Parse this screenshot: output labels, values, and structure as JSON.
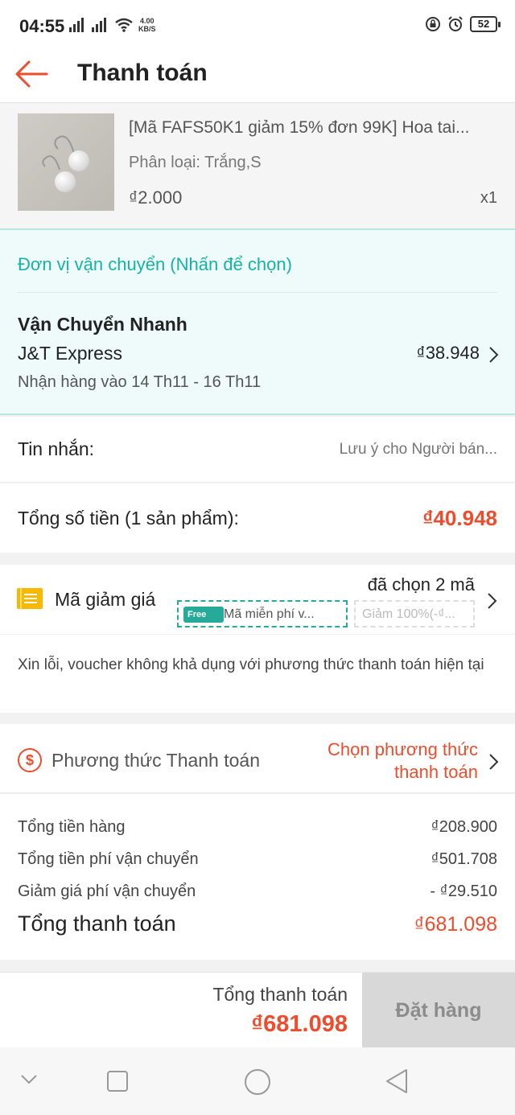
{
  "status": {
    "time": "04:55",
    "net_speed": "4.00",
    "net_unit": "KB/S",
    "battery": "52"
  },
  "header": {
    "title": "Thanh toán"
  },
  "product": {
    "name": "[Mã FAFS50K1 giảm 15% đơn 99K] Hoa tai...",
    "variant": "Phân loại: Trắng,S",
    "price": "₫2.000",
    "qty": "x1"
  },
  "shipping": {
    "header": "Đơn vị vận chuyển (Nhấn để chọn)",
    "type": "Vận Chuyển Nhanh",
    "carrier": "J&T Express",
    "fee": "₫38.948",
    "eta": "Nhận hàng vào 14 Th11 - 16 Th11"
  },
  "message": {
    "label": "Tin nhắn:",
    "placeholder": "Lưu ý cho Người bán..."
  },
  "subtotal": {
    "label": "Tổng số tiền (1 sản phẩm):",
    "value": "₫40.948"
  },
  "voucher": {
    "label": "Mã giảm giá",
    "selected": "đã chọn 2 mã",
    "free_tag": "Free",
    "chip1": "Mã miễn phí v...",
    "chip2": "Giảm 100%(-₫...",
    "warning": "Xin lỗi, voucher không khả dụng với phương thức thanh toán hiện tại"
  },
  "payment": {
    "label": "Phương thức Thanh toán",
    "choose": "Chọn phương thức thanh toán",
    "icon": "$"
  },
  "summary": {
    "rows": [
      {
        "label": "Tổng tiền hàng",
        "value": "₫208.900"
      },
      {
        "label": "Tổng tiền phí vận chuyển",
        "value": "₫501.708"
      },
      {
        "label": "Giảm giá phí vận chuyển",
        "value": "- ₫29.510"
      }
    ],
    "total_label": "Tổng thanh toán",
    "total_value": "₫681.098"
  },
  "bottom": {
    "label": "Tổng thanh toán",
    "amount": "₫681.098",
    "order_button": "Đặt hàng"
  },
  "colors": {
    "accent": "#ee4d2d",
    "teal": "#26aa99",
    "voucher_icon": "#f7b800"
  }
}
